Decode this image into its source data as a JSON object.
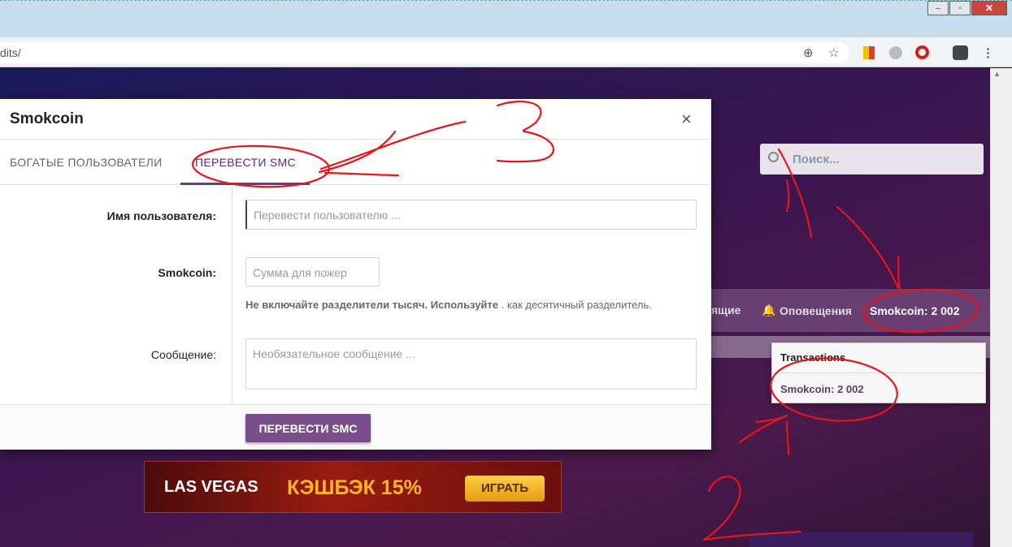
{
  "browser": {
    "url_partial": "dits/",
    "window_buttons": [
      "–",
      "▫",
      "✕"
    ]
  },
  "page": {
    "search_placeholder": "Поиск...",
    "nav_partial": "ящие",
    "nav_alerts": "Оповещения",
    "nav_balance": "Smokcoin: 2 002",
    "dropdown_title": "Transactions",
    "dropdown_item": "Smokcoin: 2 002",
    "banner_logo": "LAS VEGAS",
    "banner_text": "КЭШБЭК 15%",
    "banner_button": "ИГРАТЬ"
  },
  "modal": {
    "title": "Smokcoin",
    "close": "×",
    "tabs": [
      "БОГАТЫЕ ПОЛЬЗОВАТЕЛИ",
      "ПЕРЕВЕСТИ SMC"
    ],
    "active_tab": 1,
    "fields": {
      "username_label": "Имя пользователя:",
      "username_placeholder": "Перевести пользователю ...",
      "amount_label": "Smokcoin:",
      "amount_placeholder": "Сумма для пожер",
      "hint_bold": "Не включайте разделители тысяч. Используйте",
      "hint_rest": " . как десятичный разделитель.",
      "message_label": "Сообщение:",
      "message_placeholder": "Необязательное сообщение ..."
    },
    "submit": "ПЕРЕВЕСТИ SMC"
  },
  "annotations": {
    "color": "#e8141a",
    "numbers": [
      "3",
      "2"
    ]
  }
}
